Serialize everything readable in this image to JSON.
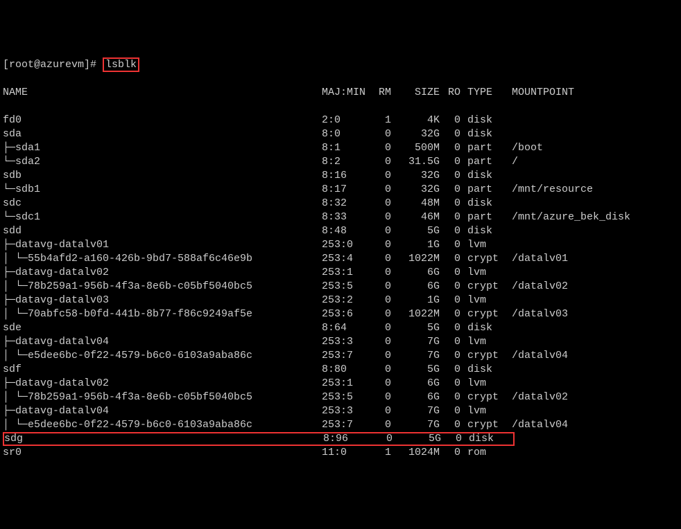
{
  "prompt": "[root@azurevm]# ",
  "command": "lsblk",
  "header": {
    "name": "NAME",
    "majmin": "MAJ:MIN",
    "rm": "RM",
    "size": "SIZE",
    "ro": "RO",
    "type": "TYPE",
    "mnt": "MOUNTPOINT"
  },
  "rows": [
    {
      "name": "fd0",
      "majmin": "2:0",
      "rm": "1",
      "size": "4K",
      "ro": "0",
      "type": "disk",
      "mnt": "",
      "hl": false
    },
    {
      "name": "sda",
      "majmin": "8:0",
      "rm": "0",
      "size": "32G",
      "ro": "0",
      "type": "disk",
      "mnt": "",
      "hl": false
    },
    {
      "name": "├─sda1",
      "majmin": "8:1",
      "rm": "0",
      "size": "500M",
      "ro": "0",
      "type": "part",
      "mnt": "/boot",
      "hl": false
    },
    {
      "name": "└─sda2",
      "majmin": "8:2",
      "rm": "0",
      "size": "31.5G",
      "ro": "0",
      "type": "part",
      "mnt": "/",
      "hl": false
    },
    {
      "name": "sdb",
      "majmin": "8:16",
      "rm": "0",
      "size": "32G",
      "ro": "0",
      "type": "disk",
      "mnt": "",
      "hl": false
    },
    {
      "name": "└─sdb1",
      "majmin": "8:17",
      "rm": "0",
      "size": "32G",
      "ro": "0",
      "type": "part",
      "mnt": "/mnt/resource",
      "hl": false
    },
    {
      "name": "sdc",
      "majmin": "8:32",
      "rm": "0",
      "size": "48M",
      "ro": "0",
      "type": "disk",
      "mnt": "",
      "hl": false
    },
    {
      "name": "└─sdc1",
      "majmin": "8:33",
      "rm": "0",
      "size": "46M",
      "ro": "0",
      "type": "part",
      "mnt": "/mnt/azure_bek_disk",
      "hl": false
    },
    {
      "name": "sdd",
      "majmin": "8:48",
      "rm": "0",
      "size": "5G",
      "ro": "0",
      "type": "disk",
      "mnt": "",
      "hl": false
    },
    {
      "name": "├─datavg-datalv01",
      "majmin": "253:0",
      "rm": "0",
      "size": "1G",
      "ro": "0",
      "type": "lvm",
      "mnt": "",
      "hl": false
    },
    {
      "name": "│ └─55b4afd2-a160-426b-9bd7-588af6c46e9b",
      "majmin": "253:4",
      "rm": "0",
      "size": "1022M",
      "ro": "0",
      "type": "crypt",
      "mnt": "/datalv01",
      "hl": false
    },
    {
      "name": "├─datavg-datalv02",
      "majmin": "253:1",
      "rm": "0",
      "size": "6G",
      "ro": "0",
      "type": "lvm",
      "mnt": "",
      "hl": false
    },
    {
      "name": "│ └─78b259a1-956b-4f3a-8e6b-c05bf5040bc5",
      "majmin": "253:5",
      "rm": "0",
      "size": "6G",
      "ro": "0",
      "type": "crypt",
      "mnt": "/datalv02",
      "hl": false
    },
    {
      "name": "├─datavg-datalv03",
      "majmin": "253:2",
      "rm": "0",
      "size": "1G",
      "ro": "0",
      "type": "lvm",
      "mnt": "",
      "hl": false
    },
    {
      "name": "│ └─70abfc58-b0fd-441b-8b77-f86c9249af5e",
      "majmin": "253:6",
      "rm": "0",
      "size": "1022M",
      "ro": "0",
      "type": "crypt",
      "mnt": "/datalv03",
      "hl": false
    },
    {
      "name": "sde",
      "majmin": "8:64",
      "rm": "0",
      "size": "5G",
      "ro": "0",
      "type": "disk",
      "mnt": "",
      "hl": false
    },
    {
      "name": "├─datavg-datalv04",
      "majmin": "253:3",
      "rm": "0",
      "size": "7G",
      "ro": "0",
      "type": "lvm",
      "mnt": "",
      "hl": false
    },
    {
      "name": "│ └─e5dee6bc-0f22-4579-b6c0-6103a9aba86c",
      "majmin": "253:7",
      "rm": "0",
      "size": "7G",
      "ro": "0",
      "type": "crypt",
      "mnt": "/datalv04",
      "hl": false
    },
    {
      "name": "sdf",
      "majmin": "8:80",
      "rm": "0",
      "size": "5G",
      "ro": "0",
      "type": "disk",
      "mnt": "",
      "hl": false
    },
    {
      "name": "├─datavg-datalv02",
      "majmin": "253:1",
      "rm": "0",
      "size": "6G",
      "ro": "0",
      "type": "lvm",
      "mnt": "",
      "hl": false
    },
    {
      "name": "│ └─78b259a1-956b-4f3a-8e6b-c05bf5040bc5",
      "majmin": "253:5",
      "rm": "0",
      "size": "6G",
      "ro": "0",
      "type": "crypt",
      "mnt": "/datalv02",
      "hl": false
    },
    {
      "name": "├─datavg-datalv04",
      "majmin": "253:3",
      "rm": "0",
      "size": "7G",
      "ro": "0",
      "type": "lvm",
      "mnt": "",
      "hl": false
    },
    {
      "name": "│ └─e5dee6bc-0f22-4579-b6c0-6103a9aba86c",
      "majmin": "253:7",
      "rm": "0",
      "size": "7G",
      "ro": "0",
      "type": "crypt",
      "mnt": "/datalv04",
      "hl": false
    },
    {
      "name": "sdg",
      "majmin": "8:96",
      "rm": "0",
      "size": "5G",
      "ro": "0",
      "type": "disk",
      "mnt": "",
      "hl": true
    },
    {
      "name": "sr0",
      "majmin": "11:0",
      "rm": "1",
      "size": "1024M",
      "ro": "0",
      "type": "rom",
      "mnt": "",
      "hl": false
    }
  ]
}
